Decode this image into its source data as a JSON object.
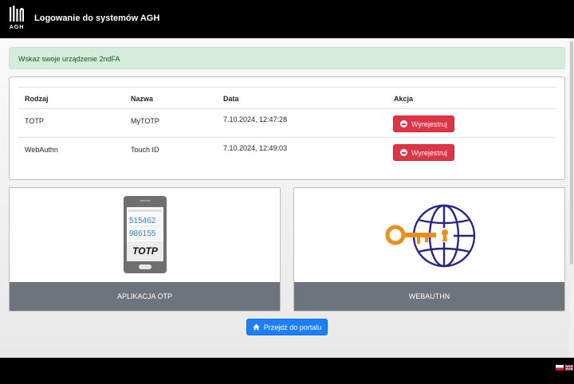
{
  "header": {
    "logo_text": "AGH",
    "title": "Logowanie do systemów AGH"
  },
  "alert": {
    "text": "Wskaż swoje urządzenie 2ndFA"
  },
  "devices_table": {
    "columns": [
      "Rodzaj",
      "Nazwa",
      "Data",
      "Akcja"
    ],
    "rows": [
      {
        "type": "TOTP",
        "name": "MyTOTP",
        "date": "7.10.2024, 12:47:28",
        "action": "Wyrejestruj"
      },
      {
        "type": "WebAuthn",
        "name": "Touch ID",
        "date": "7.10.2024, 12:49:03",
        "action": "Wyrejestruj"
      }
    ]
  },
  "methods": {
    "otp": {
      "label": "APLIKACJA OTP",
      "phone_codes": [
        "515462",
        "986155"
      ],
      "phone_caption": "TOTP"
    },
    "webauthn": {
      "label": "WEBAUTHN"
    }
  },
  "portal_button": {
    "label": "Przejdź do portalu",
    "icon": "home-icon"
  },
  "languages": [
    "pl-flag-icon",
    "en-flag-icon"
  ],
  "colors": {
    "danger": "#dc3545",
    "primary": "#1e7ef5",
    "card_footer": "#6c757d",
    "alert_bg": "#d4edda",
    "key_orange": "#e8901c",
    "globe_navy": "#26268a"
  }
}
